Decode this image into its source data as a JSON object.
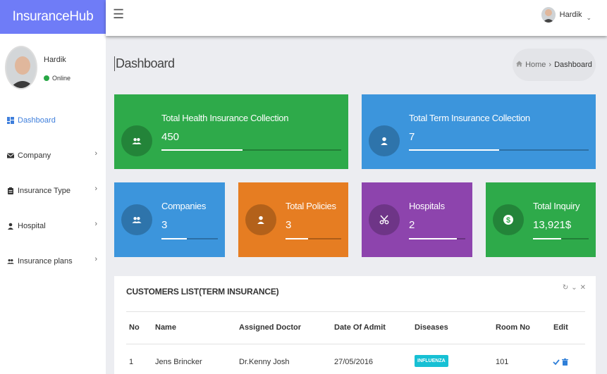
{
  "app": {
    "brand": "InsuranceHub"
  },
  "header": {
    "user_name": "Hardik"
  },
  "sidebar": {
    "profile": {
      "name": "Hardik",
      "status": "Online"
    },
    "items": [
      {
        "label": "Dashboard",
        "icon": "dashboard-icon",
        "active": true
      },
      {
        "label": "Company",
        "icon": "envelope-icon"
      },
      {
        "label": "Insurance Type",
        "icon": "clipboard-icon"
      },
      {
        "label": "Hospital",
        "icon": "person-icon"
      },
      {
        "label": "Insurance plans",
        "icon": "people-icon"
      }
    ]
  },
  "page": {
    "title": "Dashboard"
  },
  "breadcrumb": {
    "home": "Home",
    "current": "Dashboard"
  },
  "cards": [
    {
      "label": "Total Health Insurance Collection",
      "value": "450",
      "progress": 0.45,
      "color": "#2eaa4a",
      "icon": "people-icon"
    },
    {
      "label": "Total Term Insurance Collection",
      "value": "7",
      "progress": 0.5,
      "color": "#3c95dc",
      "icon": "person-icon"
    },
    {
      "label": "Companies",
      "value": "3",
      "progress": 0.45,
      "color": "#3c95dc",
      "icon": "people-icon"
    },
    {
      "label": "Total Policies",
      "value": "3",
      "progress": 0.4,
      "color": "#e67d22",
      "icon": "person-icon"
    },
    {
      "label": "Hospitals",
      "value": "2",
      "progress": 0.85,
      "color": "#8d44ad",
      "icon": "scissors-icon"
    },
    {
      "label": "Total Inquiry",
      "value": "13,921$",
      "progress": 0.5,
      "color": "#2eaa4a",
      "icon": "dollar-icon"
    }
  ],
  "table": {
    "title": "CUSTOMERS LIST(TERM INSURANCE)",
    "columns": [
      "No",
      "Name",
      "Assigned Doctor",
      "Date Of Admit",
      "Diseases",
      "Room No",
      "Edit"
    ],
    "rows": [
      {
        "no": "1",
        "name": "Jens Brincker",
        "doctor": "Dr.Kenny Josh",
        "date": "27/05/2016",
        "disease": "INFLUENZA",
        "room": "101"
      }
    ]
  }
}
